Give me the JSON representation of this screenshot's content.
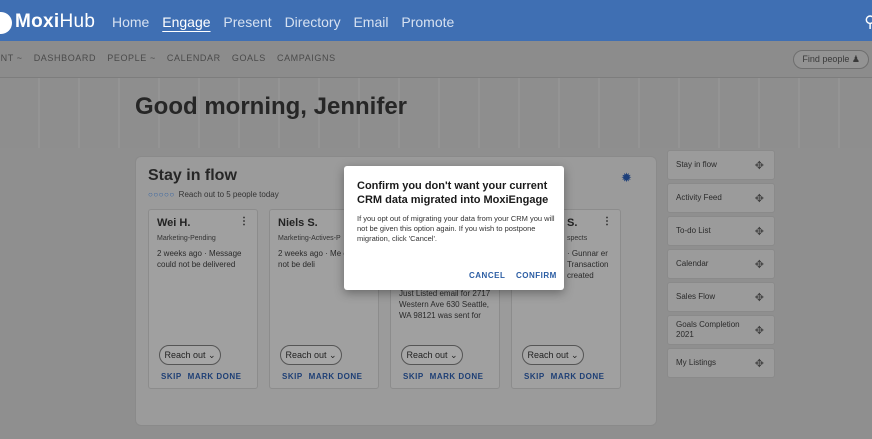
{
  "topbar": {
    "brand_moxi": "Moxi",
    "brand_hub": "Hub",
    "nav": [
      "Home",
      "Engage",
      "Present",
      "Directory",
      "Email",
      "Promote"
    ],
    "active_nav": "Engage",
    "color": "#3f6fb3"
  },
  "subnav": {
    "items": [
      "ENT ~",
      "DASHBOARD",
      "PEOPLE ~",
      "CALENDAR",
      "GOALS",
      "CAMPAIGNS"
    ],
    "find_people": "Find people"
  },
  "greeting": "Good morning, Jennifer",
  "stay_in_flow": {
    "title": "Stay in flow",
    "subtitle": "Reach out to 5 people today",
    "dots": "○○○○○",
    "people": [
      {
        "name": "Wei H.",
        "tag": "Marketing-Pending",
        "message": "2 weeks ago · Message could not be delivered"
      },
      {
        "name": "Niels S.",
        "tag": "Marketing-Actives-P",
        "message": "2 weeks ago · Me could not be deli"
      },
      {
        "name": "",
        "tag": "",
        "message": "Just Listed email for 2717 Western Ave 630 Seattle, WA 98121 was sent for"
      },
      {
        "name": "S.",
        "tag": "spects",
        "message": "· Gunnar er Transaction created"
      }
    ],
    "reach_out": "Reach out",
    "skip": "SKIP",
    "mark_done": "MARK DONE"
  },
  "widgets": [
    "Stay in flow",
    "Activity Feed",
    "To-do List",
    "Calendar",
    "Sales Flow",
    "Goals Completion 2021",
    "My Listings"
  ],
  "modal": {
    "title": "Confirm you don't want your current CRM data migrated into MoxiEngage",
    "body": "If you opt out of migrating your data from your CRM you will not be given this option again. If you wish to postpone migration, click 'Cancel'.",
    "cancel": "CANCEL",
    "confirm": "CONFIRM",
    "accent": "#2b5da3"
  }
}
